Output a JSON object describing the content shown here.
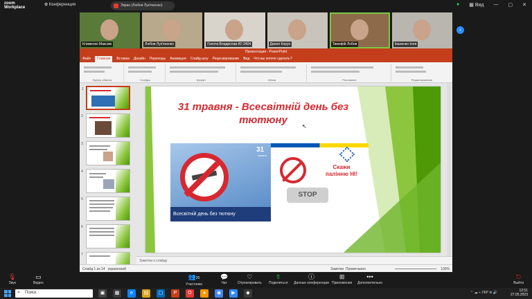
{
  "zoom": {
    "logo_line1": "zoom",
    "logo_line2": "Workplace",
    "conference_label": "Конференция",
    "screen_share_label": "Экран (Любов Лук'яненко)",
    "view_label": "Вид",
    "participants_tiles": [
      {
        "name": "Клименко Максим"
      },
      {
        "name": "Любов Лук'яненко"
      },
      {
        "name": "Голота Владислав АТ-2404"
      },
      {
        "name": "Данил Корун"
      },
      {
        "name": "Тимофій Лобов"
      },
      {
        "name": "Іваненко Ілля"
      }
    ],
    "toolbar": {
      "audio": "Звук",
      "video": "Видео",
      "participants": "Участники",
      "participants_count": "20",
      "chat": "Чат",
      "react": "Отреагировать",
      "share": "Поделиться",
      "conf_data": "Данные конференции",
      "apps": "Приложения",
      "more": "Дополнительно",
      "leave": "Выйти"
    }
  },
  "powerpoint": {
    "title": "Презентация - PowerPoint",
    "tabs": [
      "Файл",
      "Главная",
      "Вставка",
      "Дизайн",
      "Переходы",
      "Анимация",
      "Слайд-шоу",
      "Рецензирование",
      "Вид",
      "Что вы хотите сделать?"
    ],
    "selected_tab": "Главная",
    "ribbon_groups": [
      "Буфер обмена",
      "Слайды",
      "Шрифт",
      "Абзац",
      "Рисование",
      "Редактирование"
    ],
    "slide_title": "31 травня - Всесвітній день без тютюну",
    "banner": {
      "date_number": "31",
      "date_month": "травня",
      "caption": "Всесвітній день без тютюну",
      "say_line1": "Скажи",
      "say_line2": "палінню НІ!",
      "stop": "STOP"
    },
    "thumbnail_numbers": [
      "1",
      "2",
      "3",
      "4",
      "5",
      "6",
      "7"
    ],
    "notes_placeholder": "Заметки к слайду",
    "status_left": "Слайд 1 из 14",
    "status_lang": "украинский",
    "status_notes": "Заметки",
    "status_comments": "Примечания",
    "zoom_level": "100%"
  },
  "taskbar": {
    "search_placeholder": "Поиск",
    "lang": "УКР",
    "time": "12:51",
    "date": "27.05.2023"
  },
  "colors": {
    "ppt_accent": "#c43e1c",
    "slide_title": "#d7282f",
    "slide_green": "#8cc63f",
    "zoom_bg": "#1a1a1a"
  }
}
